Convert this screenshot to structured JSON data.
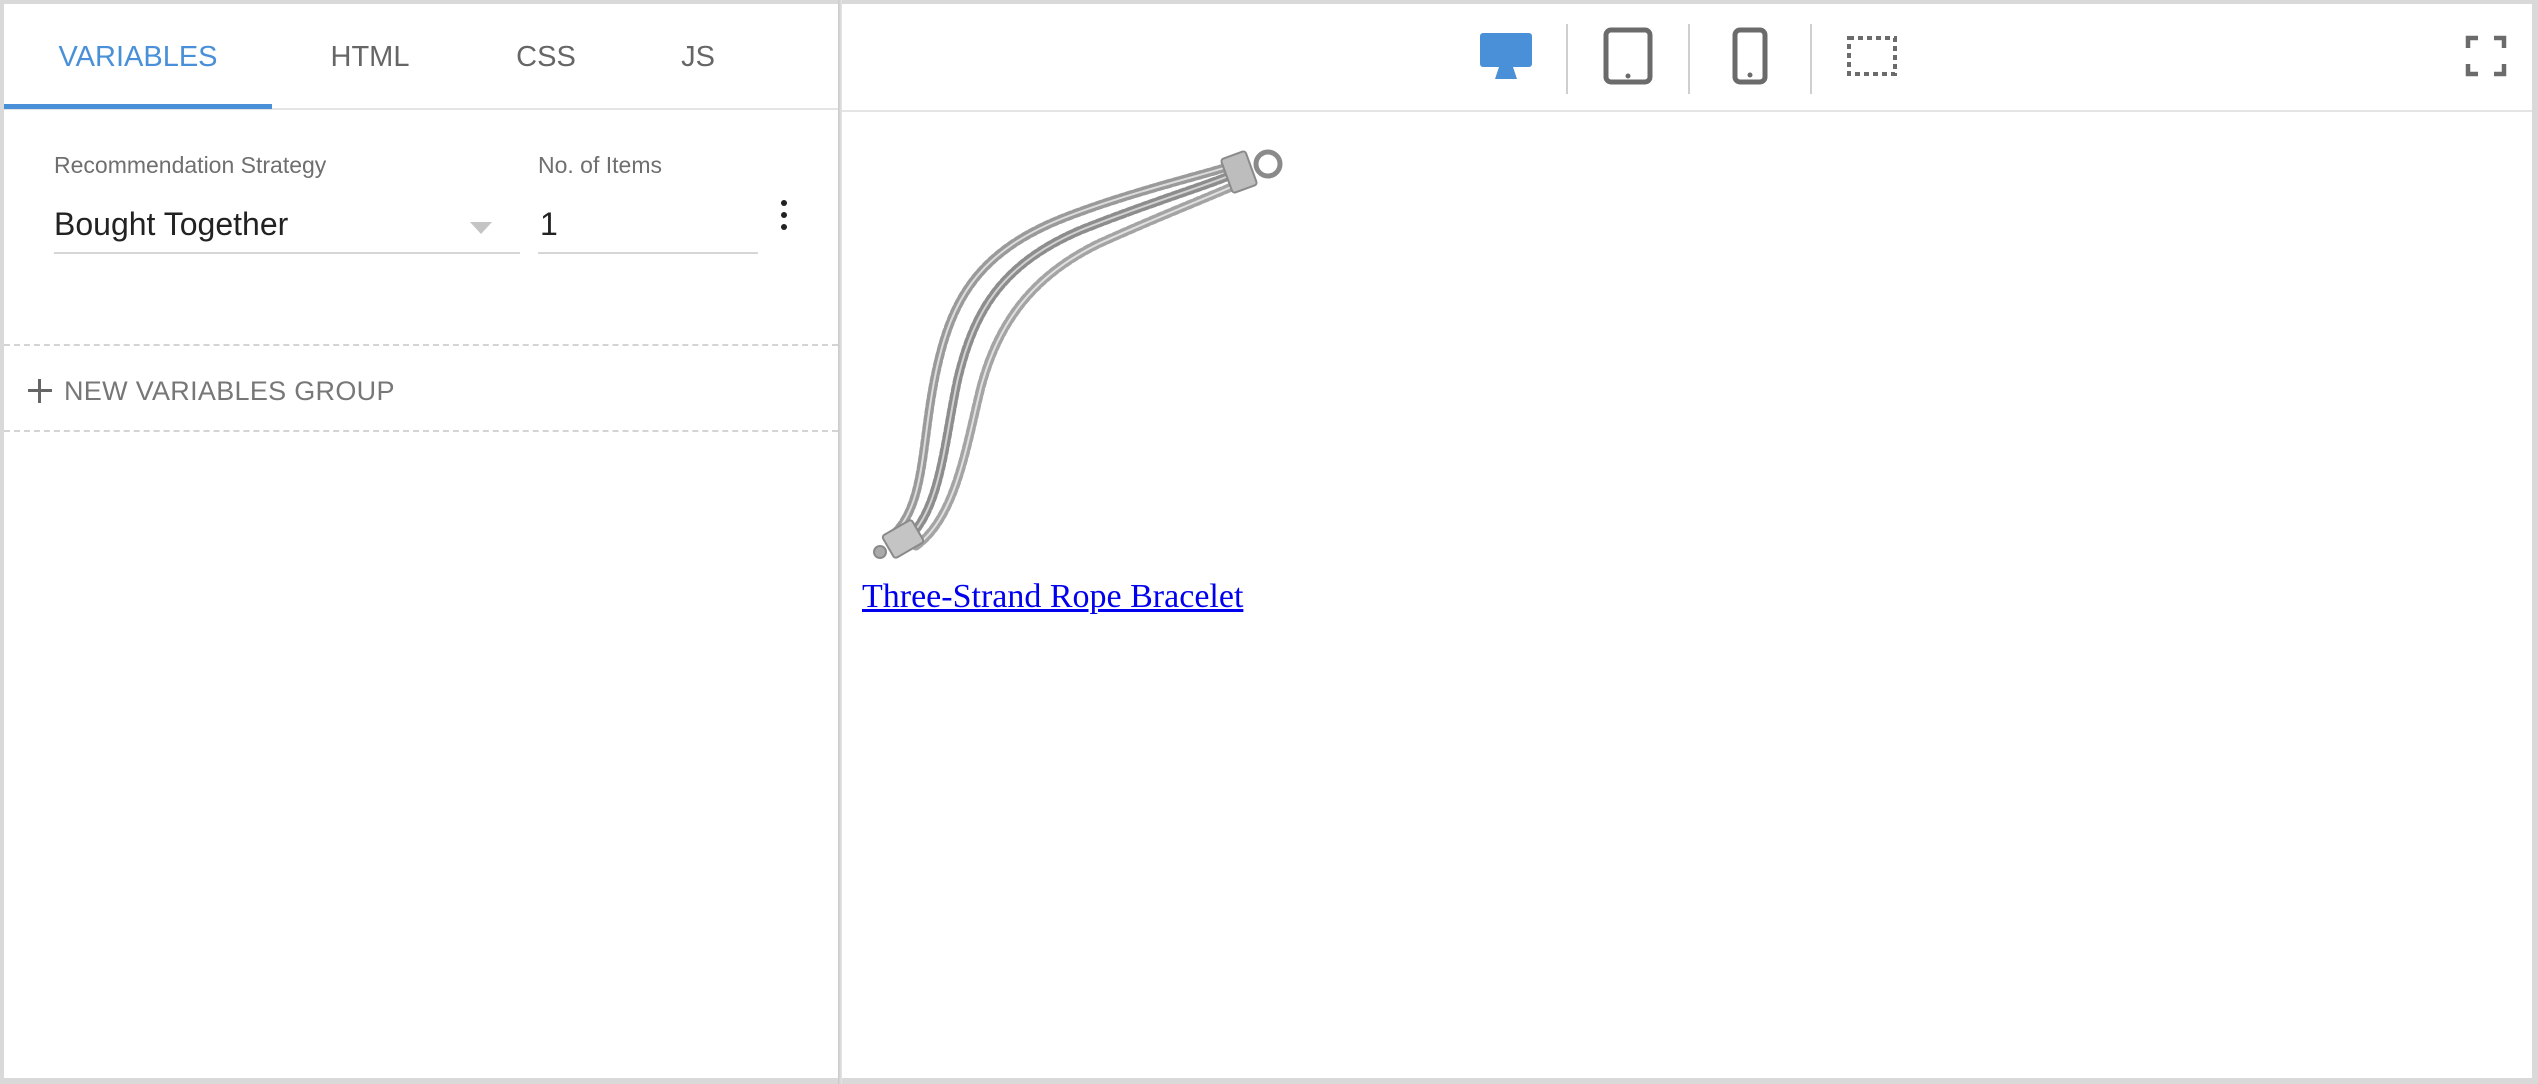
{
  "tabs": [
    {
      "label": "VARIABLES",
      "active": true
    },
    {
      "label": "HTML",
      "active": false
    },
    {
      "label": "CSS",
      "active": false
    },
    {
      "label": "JS",
      "active": false
    }
  ],
  "variables": {
    "strategy": {
      "label": "Recommendation Strategy",
      "value": "Bought Together"
    },
    "items": {
      "label": "No. of Items",
      "value": "1"
    }
  },
  "new_group_label": "NEW VARIABLES GROUP",
  "toolbar": {
    "devices": [
      {
        "icon": "desktop-icon",
        "active": true
      },
      {
        "icon": "tablet-icon",
        "active": false
      },
      {
        "icon": "mobile-icon",
        "active": false
      },
      {
        "icon": "custom-size-icon",
        "active": false
      }
    ],
    "expand_icon": "fullscreen-icon"
  },
  "preview": {
    "product_name": "Three-Strand Rope Bracelet",
    "product_image_icon": "bracelet-image"
  },
  "colors": {
    "accent": "#4a90d9",
    "link": "#0000ee",
    "muted_text": "#666666"
  }
}
